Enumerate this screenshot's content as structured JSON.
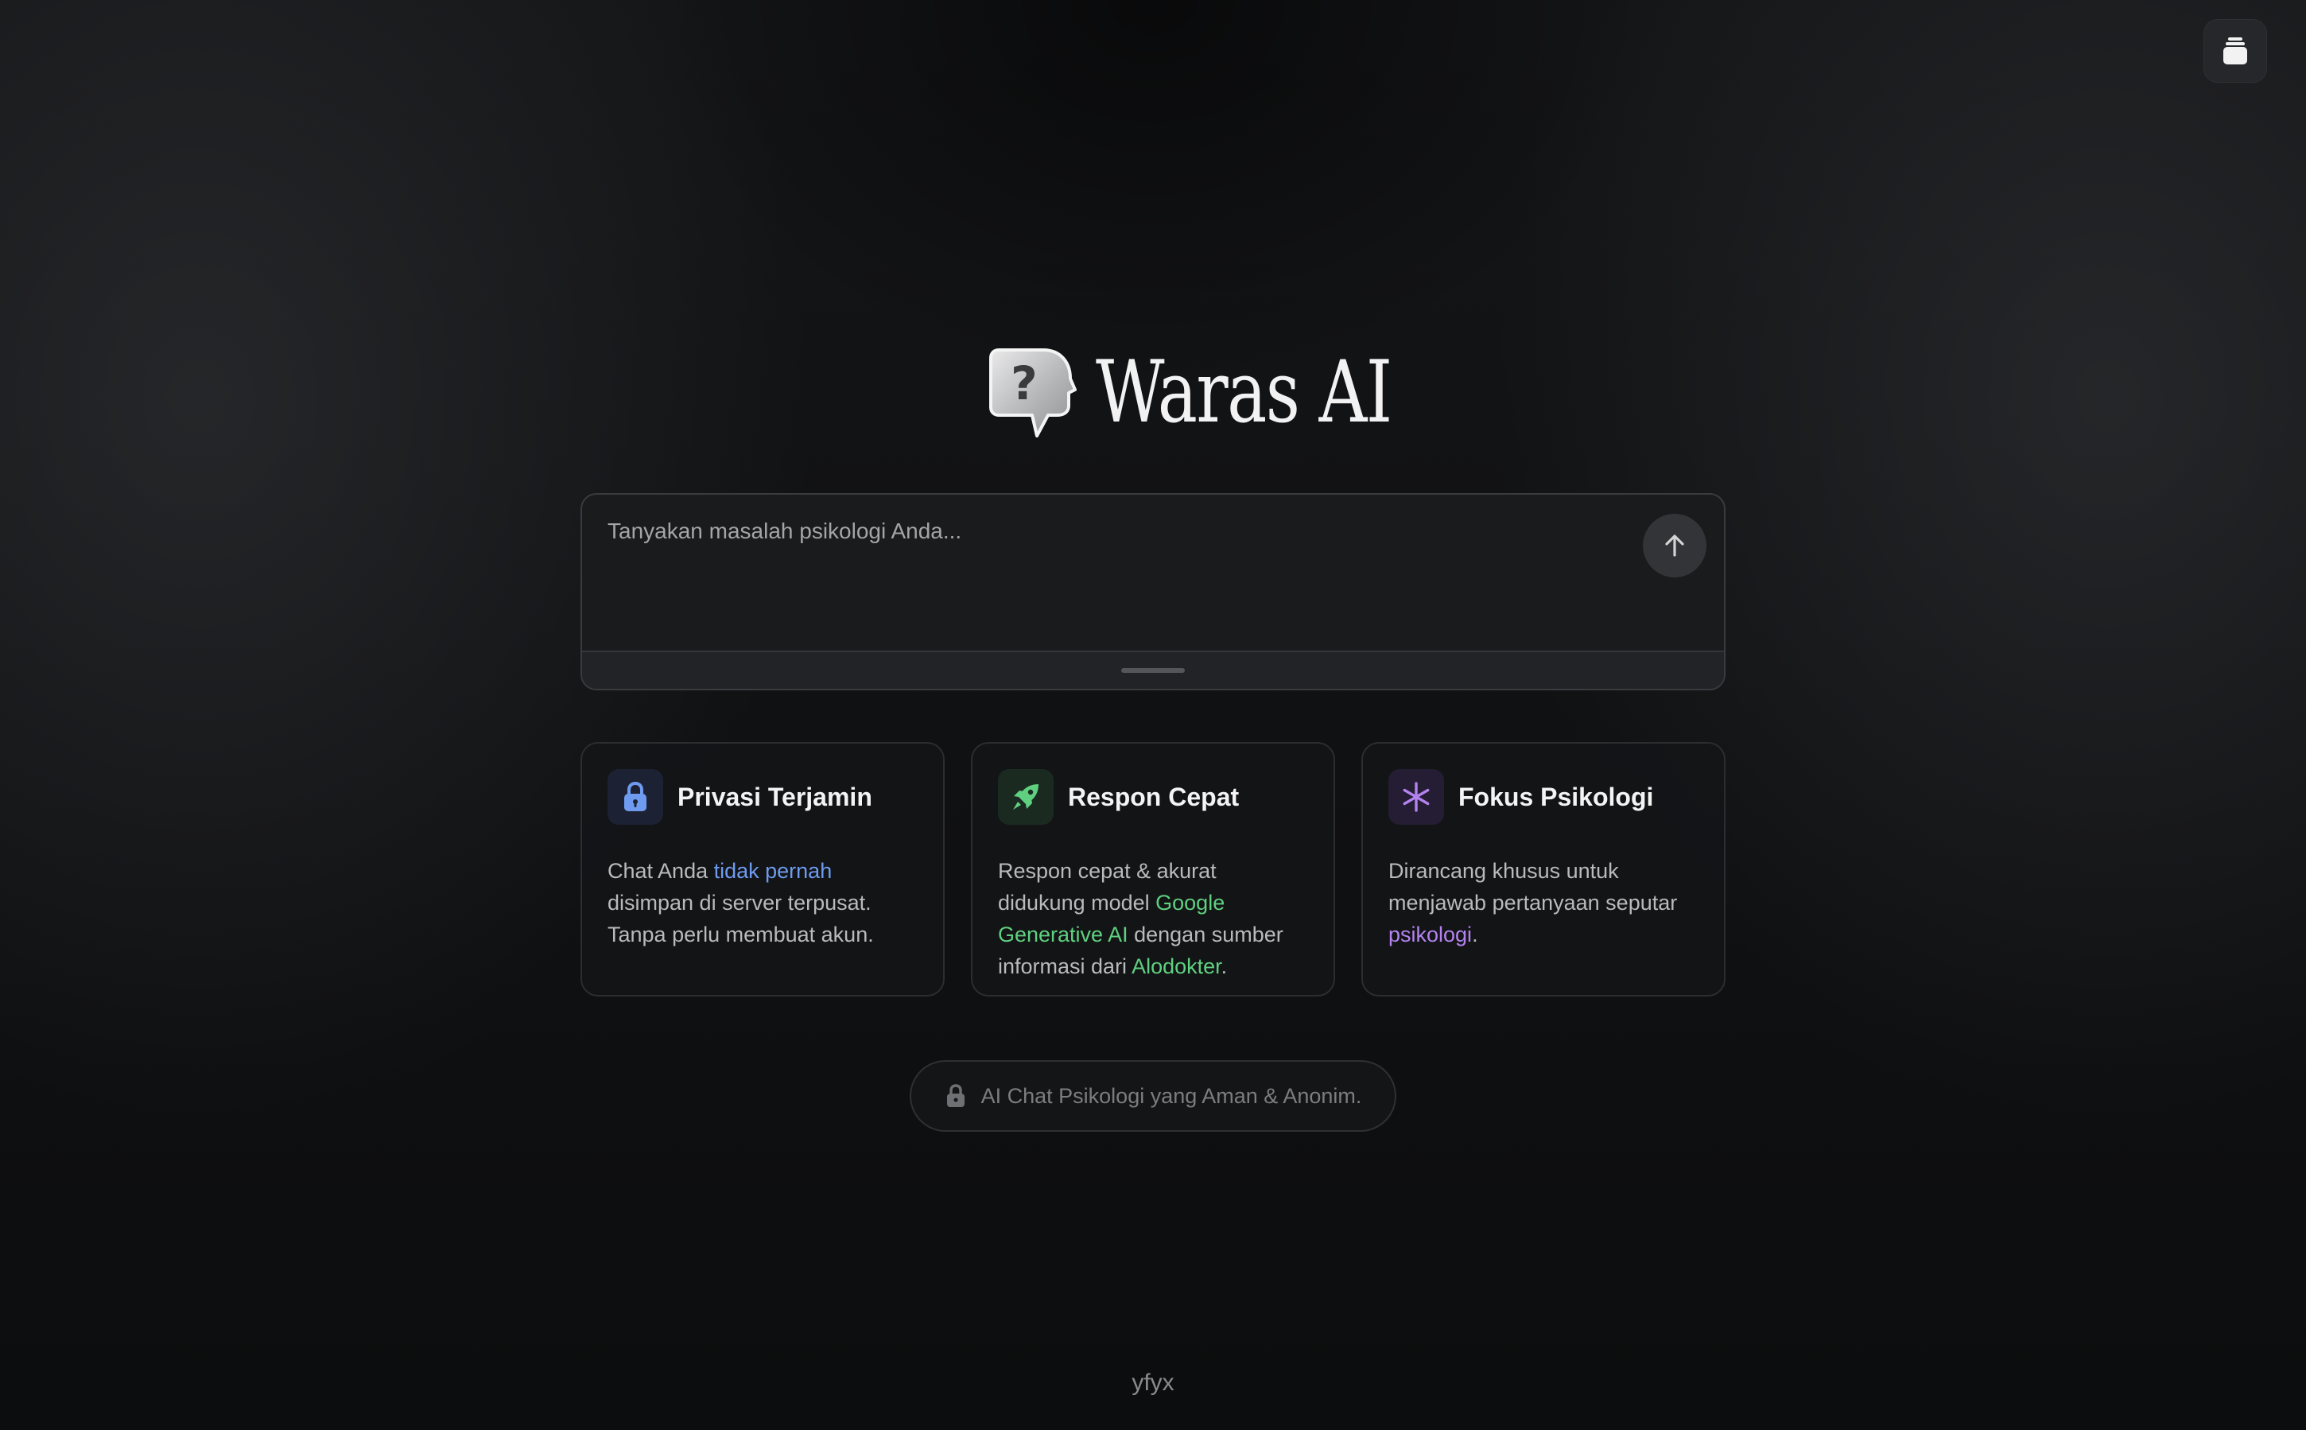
{
  "brand": {
    "title": "Waras AI"
  },
  "prompt": {
    "placeholder": "Tanyakan masalah psikologi Anda..."
  },
  "cards": [
    {
      "title": "Privasi Terjamin",
      "icon": "lock-icon",
      "accent": "#6e9bf0",
      "body": [
        {
          "text": "Chat Anda "
        },
        {
          "text": "tidak pernah",
          "highlight": true
        },
        {
          "text": " disimpan di server terpusat. Tanpa perlu membuat akun."
        }
      ]
    },
    {
      "title": "Respon Cepat",
      "icon": "rocket-icon",
      "accent": "#5fd080",
      "body": [
        {
          "text": "Respon cepat & akurat didukung model "
        },
        {
          "text": "Google Generative AI",
          "highlight": true
        },
        {
          "text": " dengan sumber informasi dari "
        },
        {
          "text": "Alodokter",
          "highlight": true
        },
        {
          "text": "."
        }
      ]
    },
    {
      "title": "Fokus Psikologi",
      "icon": "asterisk-icon",
      "accent": "#b483f0",
      "body": [
        {
          "text": "Dirancang khusus untuk menjawab pertanyaan seputar "
        },
        {
          "text": "psikologi",
          "highlight": true
        },
        {
          "text": "."
        }
      ]
    }
  ],
  "pill": {
    "text": "AI Chat Psikologi yang Aman & Anonim.",
    "icon": "lock-icon"
  },
  "footer": {
    "text": "yfyx"
  },
  "colors": {
    "background": "#111214",
    "blue": "#6e9bf0",
    "green": "#5fd080",
    "purple": "#b483f0"
  }
}
